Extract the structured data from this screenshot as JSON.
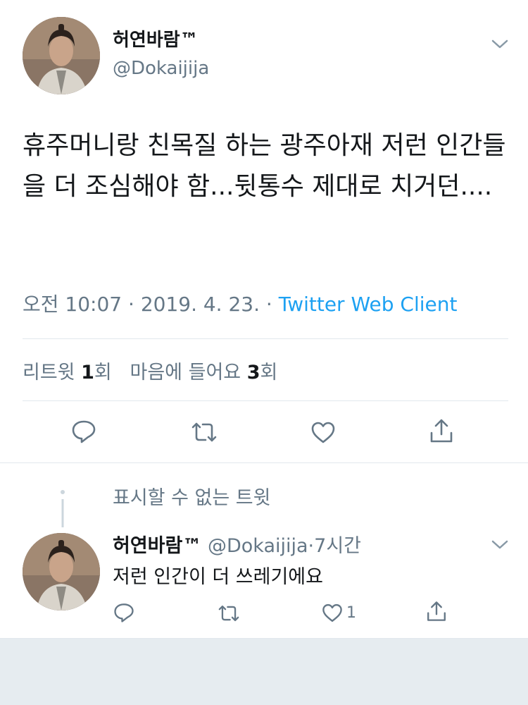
{
  "tweet": {
    "author_name": "허연바람™",
    "author_handle": "@Dokaijija",
    "text": "휴주머니랑 친목질 하는 광주아재 저런 인간들을 더 조심해야 함...뒷통수 제대로 치거던....",
    "meta_time": "오전 10:07 · 2019. 4. 23. · ",
    "meta_source": "Twitter Web Client",
    "stats": {
      "retweets_label": "리트윗 ",
      "retweets_count": "1",
      "retweets_unit": "회",
      "likes_label": "마음에 들어요 ",
      "likes_count": "3",
      "likes_unit": "회"
    },
    "actions": [
      "reply-icon",
      "retweet-icon",
      "like-icon",
      "share-icon"
    ]
  },
  "unavailable_tweet": {
    "text": "표시할 수 없는 트윗"
  },
  "reply": {
    "author_name": "허연바람™",
    "author_handle": "@Dokaijija",
    "time": "7시간",
    "text": "저런 인간이 더 쓰레기에요",
    "like_count": "1",
    "actions": [
      "reply-icon",
      "retweet-icon",
      "like-icon",
      "share-icon"
    ]
  },
  "colors": {
    "link": "#1da1f2",
    "secondary_text": "#657786",
    "divider": "#e1e8ed",
    "footer_bg": "#e6ecf0"
  }
}
